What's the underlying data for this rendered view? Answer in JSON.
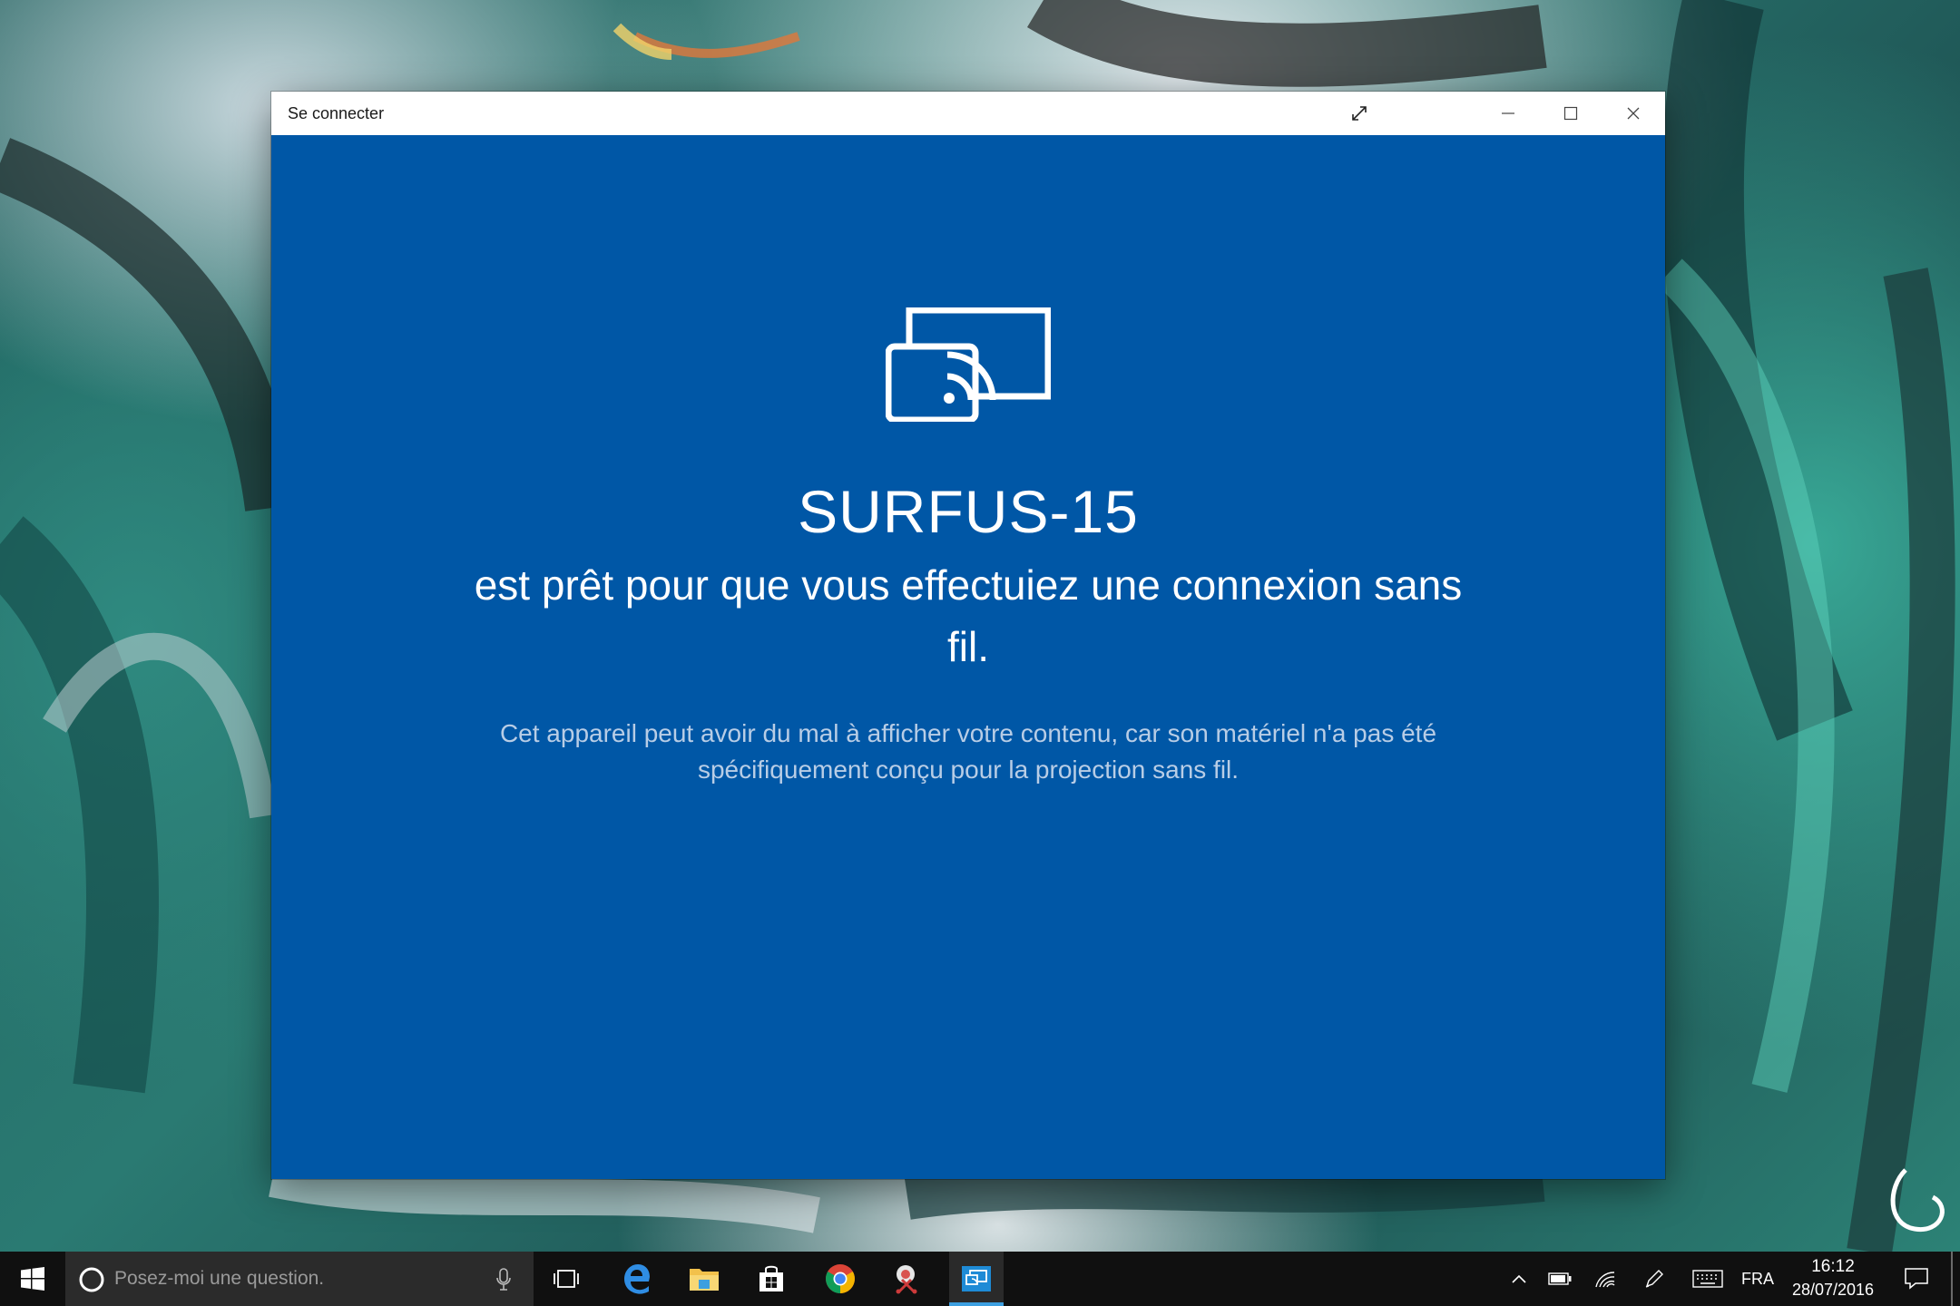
{
  "window": {
    "title": "Se connecter"
  },
  "content": {
    "icon": "wireless-display-icon",
    "device_name": "SURFUS-15",
    "ready_message": "est prêt pour que vous effectuiez une connexion sans fil.",
    "warning_message": "Cet appareil peut avoir du mal à afficher votre contenu, car son matériel n'a pas été spécifiquement conçu pour la projection sans fil."
  },
  "taskbar": {
    "search_placeholder": "Posez-moi une question.",
    "apps": [
      "start-icon",
      "cortana-icon",
      "microphone-icon",
      "task-view-icon",
      "edge-icon",
      "file-explorer-icon",
      "store-icon",
      "chrome-icon",
      "snipping-tool-icon",
      "connect-app-icon"
    ],
    "tray": {
      "language": "FRA",
      "time": "16:12",
      "date": "28/07/2016"
    }
  },
  "colors": {
    "window_bg": "#0057a6",
    "taskbar_bg": "#101010",
    "search_bg": "#2b2b2b",
    "accent": "#3c9fe0"
  }
}
